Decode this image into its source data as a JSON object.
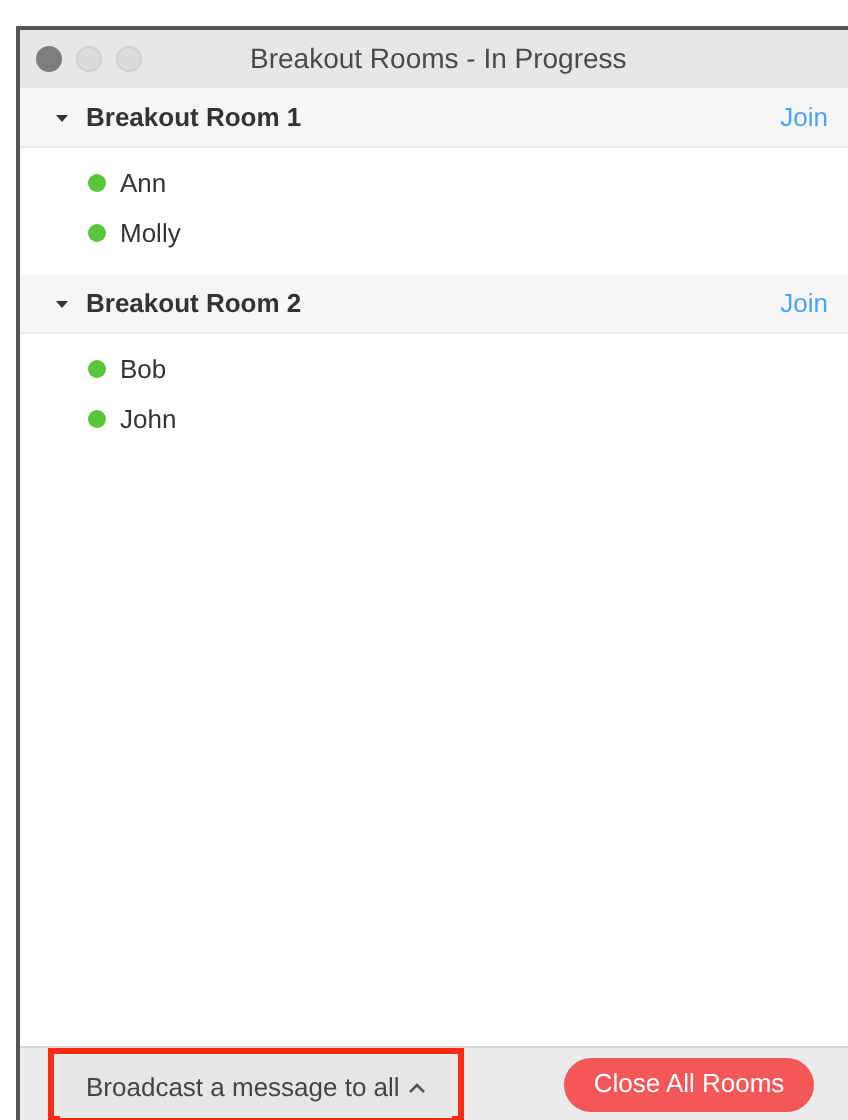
{
  "window": {
    "title": "Breakout Rooms - In Progress"
  },
  "rooms": [
    {
      "name": "Breakout Room 1",
      "expanded": true,
      "action": "Join",
      "members": [
        {
          "name": "Ann",
          "color": "#5ac43a"
        },
        {
          "name": "Molly",
          "color": "#5ac43a"
        }
      ]
    },
    {
      "name": "Breakout Room 2",
      "expanded": true,
      "action": "Join",
      "members": [
        {
          "name": "Bob",
          "color": "#5ac43a"
        },
        {
          "name": "John",
          "color": "#5ac43a"
        }
      ]
    }
  ],
  "footer": {
    "broadcast": {
      "label": "Broadcast a message to all",
      "highlighted": true
    },
    "close_button": "Close All Rooms"
  }
}
